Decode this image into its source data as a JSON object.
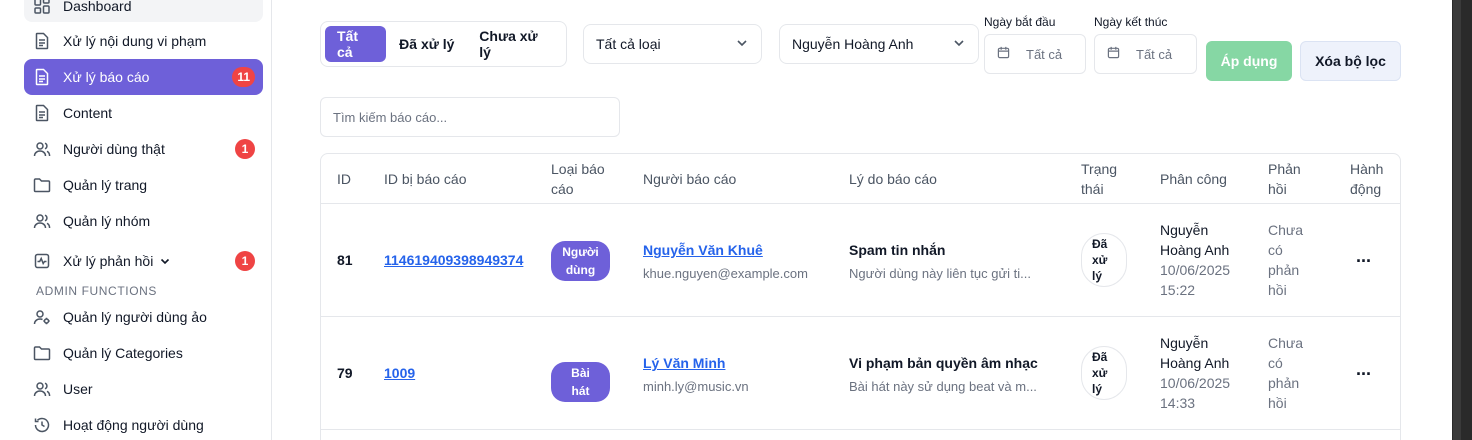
{
  "sidebar": {
    "items": [
      {
        "label": "Dashboard",
        "icon": "grid-icon"
      },
      {
        "label": "Xử lý nội dung vi phạm",
        "icon": "document-icon"
      },
      {
        "label": "Xử lý báo cáo",
        "icon": "document-icon",
        "badge": "11",
        "active": true
      },
      {
        "label": "Content",
        "icon": "document-icon"
      },
      {
        "label": "Người dùng thật",
        "icon": "users-icon",
        "badge": "1"
      },
      {
        "label": "Quản lý trang",
        "icon": "folder-icon"
      },
      {
        "label": "Quản lý nhóm",
        "icon": "users-icon"
      },
      {
        "label": "Xử lý phản hồi",
        "icon": "activity-icon",
        "badge": "1",
        "chevron": "chevron-down-icon"
      },
      {
        "label": "Quản lý người dùng ảo",
        "icon": "user-gear-icon"
      },
      {
        "label": "Quản lý Categories",
        "icon": "folder-icon"
      },
      {
        "label": "User",
        "icon": "users-icon"
      },
      {
        "label": "Hoạt động người dùng",
        "icon": "history-icon"
      }
    ],
    "section_label": "ADMIN FUNCTIONS"
  },
  "filters": {
    "tabs": [
      "Tất cả",
      "Đã xử lý",
      "Chưa xử lý"
    ],
    "type_select": "Tất cả loại",
    "assignee_select": "Nguyễn Hoàng Anh",
    "start_date_label": "Ngày bắt đầu",
    "end_date_label": "Ngày kết thúc",
    "start_date_value": "Tất cả",
    "end_date_value": "Tất cả",
    "apply_label": "Áp dụng",
    "clear_label": "Xóa bộ lọc"
  },
  "search": {
    "placeholder": "Tìm kiếm báo cáo..."
  },
  "table": {
    "headers": {
      "id": "ID",
      "target_id": "ID bị báo cáo",
      "type": [
        "Loại báo",
        "cáo"
      ],
      "reporter": "Người báo cáo",
      "reason": "Lý do báo cáo",
      "status": [
        "Trạng",
        "thái"
      ],
      "assignee": "Phân công",
      "feedback": [
        "Phản",
        "hồi"
      ],
      "action": [
        "Hành",
        "động"
      ]
    },
    "rows": [
      {
        "id": "81",
        "target_id": "114619409398949374",
        "type": [
          "Người",
          "dùng"
        ],
        "reporter_name": "Nguyễn Văn Khuê",
        "reporter_email": "khue.nguyen@example.com",
        "reason_title": "Spam tin nhắn",
        "reason_desc": "Người dùng này liên tục gửi ti...",
        "status": [
          "Đã",
          "xử",
          "lý"
        ],
        "assignee": [
          "Nguyễn",
          "Hoàng Anh"
        ],
        "assigned_date": "10/06/2025",
        "assigned_time": "15:22",
        "feedback": [
          "Chưa",
          "có",
          "phản",
          "hồi"
        ],
        "action": "..."
      },
      {
        "id": "79",
        "target_id": "1009",
        "type": [
          "Bài hát"
        ],
        "reporter_name": "Lý Văn Minh",
        "reporter_email": "minh.ly@music.vn",
        "reason_title": "Vi phạm bản quyền âm nhạc",
        "reason_desc": "Bài hát này sử dụng beat và m...",
        "status": [
          "Đã",
          "xử",
          "lý"
        ],
        "assignee": [
          "Nguyễn",
          "Hoàng Anh"
        ],
        "assigned_date": "10/06/2025",
        "assigned_time": "14:33",
        "feedback": [
          "Chưa",
          "có",
          "phản",
          "hồi"
        ],
        "action": "..."
      }
    ]
  },
  "colors": {
    "accent": "#6e60d9",
    "badge": "#ef4444",
    "link": "#2563eb",
    "apply": "#86d7a4"
  }
}
